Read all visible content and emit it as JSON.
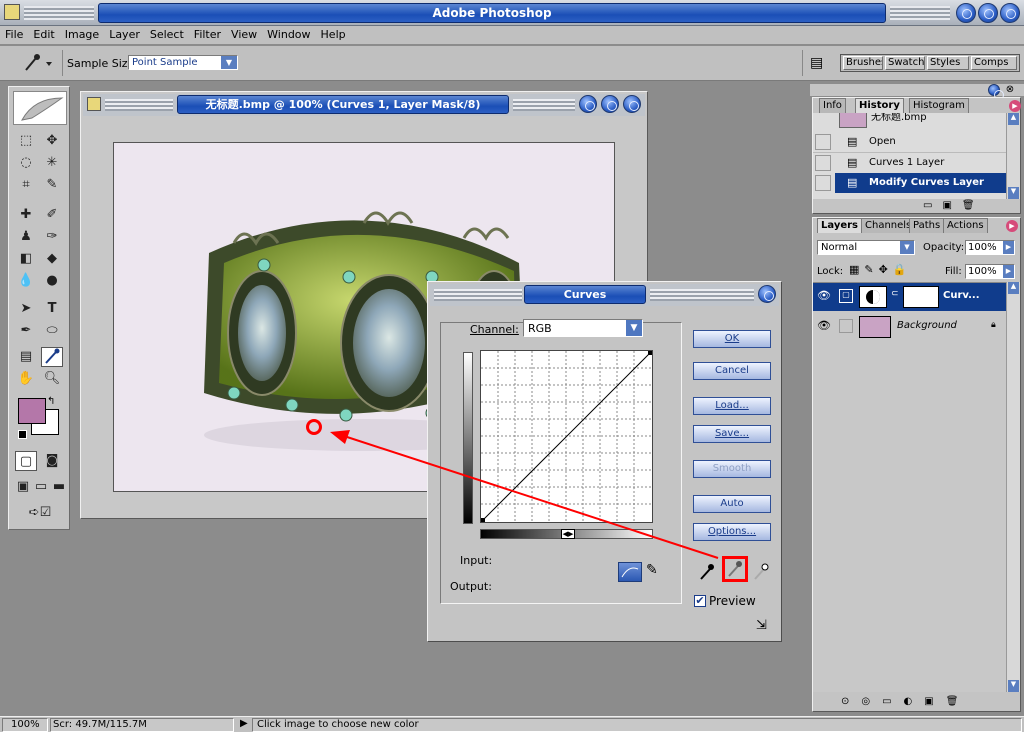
{
  "app": {
    "title": "Adobe Photoshop",
    "menu": [
      "File",
      "Edit",
      "Image",
      "Layer",
      "Select",
      "Filter",
      "View",
      "Window",
      "Help"
    ]
  },
  "options_bar": {
    "sample_size_label": "Sample Size:",
    "sample_size_value": "Point Sample",
    "well_tabs": [
      "Brushes",
      "Swatch",
      "Styles",
      "Comps"
    ]
  },
  "document": {
    "title": "无标题.bmp @ 100% (Curves 1, Layer Mask/8)"
  },
  "curves_dialog": {
    "title": "Curves",
    "channel_label": "Channel:",
    "channel_value": "RGB",
    "buttons": [
      "OK",
      "Cancel",
      "Load...",
      "Save...",
      "Smooth",
      "Auto",
      "Options..."
    ],
    "input_label": "Input:",
    "output_label": "Output:",
    "preview_label": "Preview",
    "preview_checked": true
  },
  "history_panel": {
    "tabs": [
      "Info",
      "History",
      "Histogram"
    ],
    "snapshot": "无标题.bmp",
    "items": [
      "Open",
      "Curves 1 Layer",
      "Modify Curves Layer"
    ],
    "selected_index": 2
  },
  "layers_panel": {
    "tabs": [
      "Layers",
      "Channels",
      "Paths",
      "Actions"
    ],
    "blend_mode": "Normal",
    "opacity_label": "Opacity:",
    "opacity_value": "100%",
    "lock_label": "Lock:",
    "fill_label": "Fill:",
    "fill_value": "100%",
    "layers": [
      {
        "name": "Curv...",
        "selected": true
      },
      {
        "name": "Background",
        "selected": false
      }
    ]
  },
  "status_bar": {
    "zoom": "100%",
    "scratch": "Scr: 49.7M/115.7M",
    "hint": "Click image to choose new color"
  },
  "colors": {
    "foreground": "#b477a9",
    "background": "#ffffff",
    "annotation": "#ff0000",
    "selection": "#103c8c"
  }
}
